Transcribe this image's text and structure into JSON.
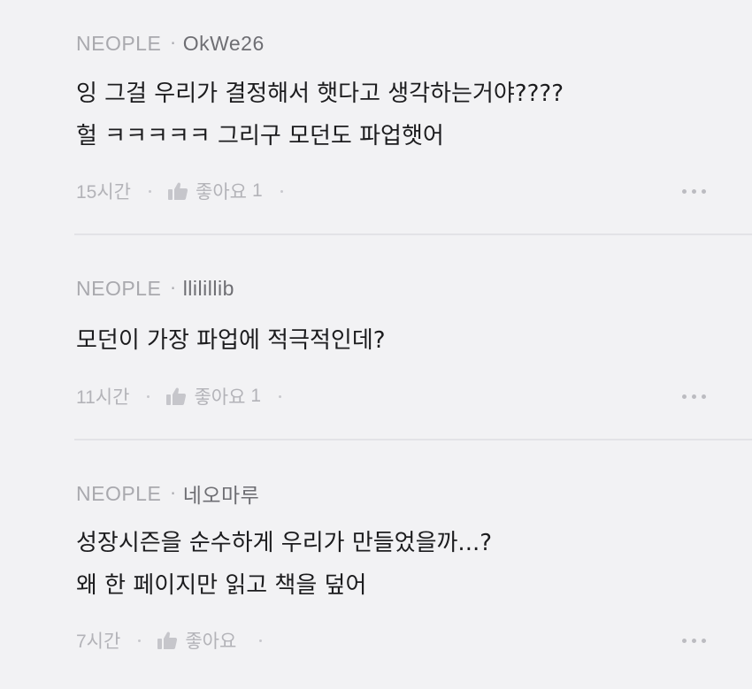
{
  "comments": [
    {
      "source": "NEOPLE",
      "separator": "·",
      "author": "OkWe26",
      "lines": [
        "잉 그걸 우리가 결정해서 햇다고 생각하는거야????",
        "헐 ㅋㅋㅋㅋㅋ 그리구 모던도 파업햇어"
      ],
      "time": "15시간",
      "like_label": "좋아요",
      "like_count": "1"
    },
    {
      "source": "NEOPLE",
      "separator": "·",
      "author": "llilillib",
      "lines": [
        "모던이 가장 파업에 적극적인데?"
      ],
      "time": "11시간",
      "like_label": "좋아요",
      "like_count": "1"
    },
    {
      "source": "NEOPLE",
      "separator": "·",
      "author": "네오마루",
      "lines": [
        "성장시즌을 순수하게 우리가 만들었을까...?",
        "왜 한 페이지만 읽고 책을 덮어"
      ],
      "time": "7시간",
      "like_label": "좋아요",
      "like_count": ""
    }
  ],
  "icons": {
    "like": "thumbs-up-icon",
    "more": "more-horizontal-icon"
  },
  "colors": {
    "background": "#f2f2f4",
    "text": "#1c1c1e",
    "muted": "#a9a9ae",
    "author": "#6e6e73"
  }
}
